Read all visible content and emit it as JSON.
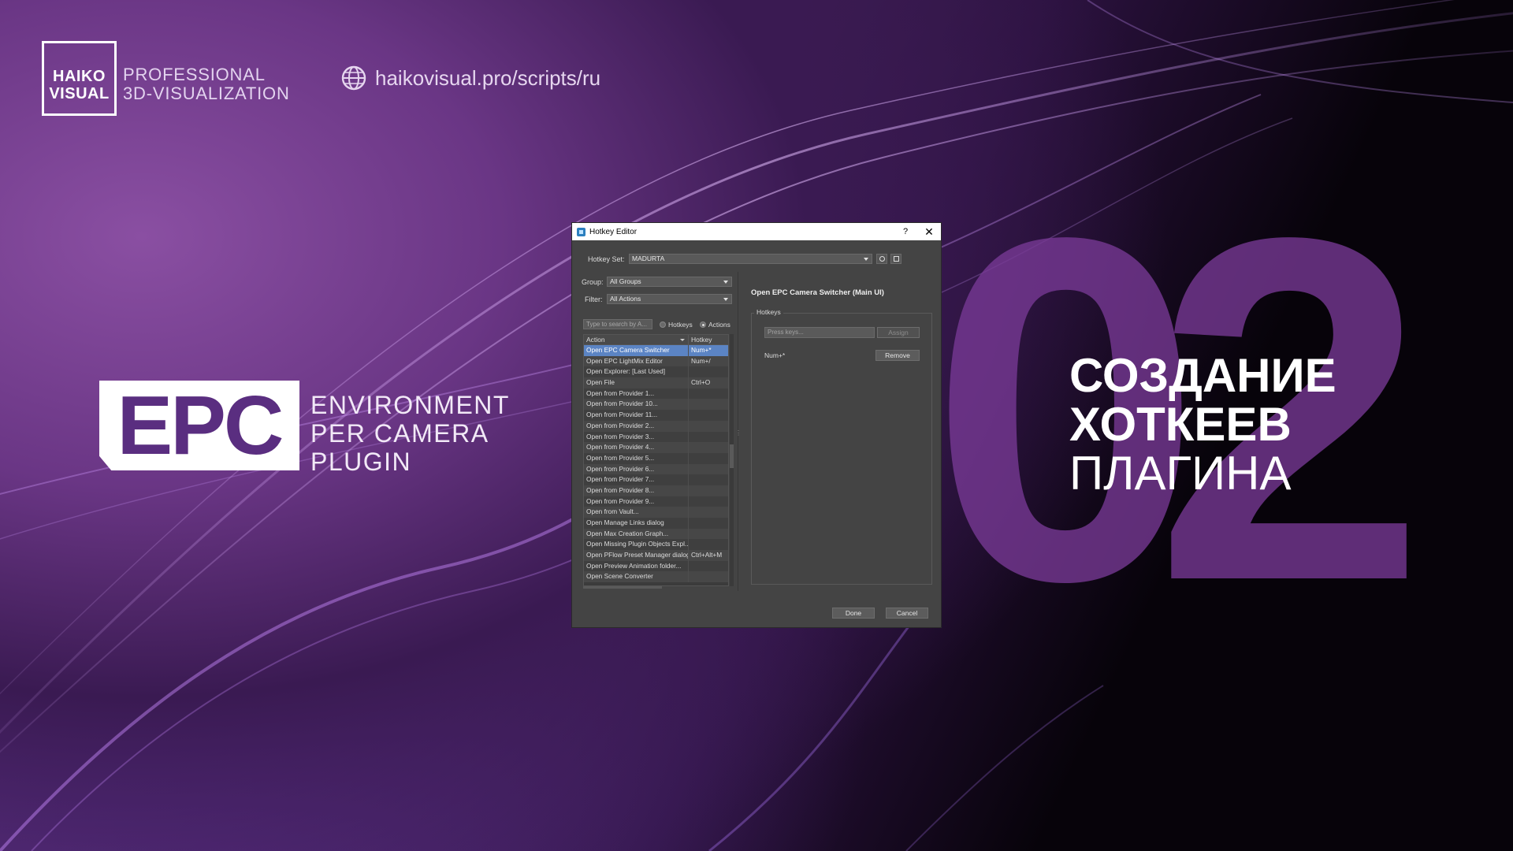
{
  "brand": {
    "box_line1": "HAIKO",
    "box_line2": "VISUAL",
    "tagline_line1": "PROFESSIONAL",
    "tagline_line2": "3D-VISUALIZATION",
    "url": "haikovisual.pro/scripts/ru"
  },
  "product": {
    "logo_text": "EPC",
    "name_line1": "ENVIRONMENT",
    "name_line2": "PER CAMERA",
    "name_line3": "PLUGIN"
  },
  "episode": {
    "number": "02",
    "heading_line1": "СОЗДАНИЕ",
    "heading_line2": "ХОТКЕЕВ",
    "heading_line3": "ПЛАГИНА"
  },
  "dialog": {
    "title": "Hotkey Editor",
    "help_glyph": "?",
    "close_glyph": "✕",
    "hotkey_set_label": "Hotkey Set:",
    "hotkey_set_value": "MADURTA",
    "group_label": "Group:",
    "group_value": "All Groups",
    "filter_label": "Filter:",
    "filter_value": "All Actions",
    "search_placeholder": "Type to search by A...",
    "radio_hotkeys": "Hotkeys",
    "radio_actions": "Actions",
    "col_action": "Action",
    "col_hotkey": "Hotkey",
    "rows": [
      {
        "action": "Open EPC Camera Switcher",
        "hotkey": "Num+*",
        "selected": true
      },
      {
        "action": "Open EPC LightMix Editor",
        "hotkey": "Num+/"
      },
      {
        "action": "Open Explorer: [Last Used]",
        "hotkey": ""
      },
      {
        "action": "Open File",
        "hotkey": "Ctrl+O"
      },
      {
        "action": "Open from Provider 1...",
        "hotkey": ""
      },
      {
        "action": "Open from Provider 10...",
        "hotkey": ""
      },
      {
        "action": "Open from Provider 11...",
        "hotkey": ""
      },
      {
        "action": "Open from Provider 2...",
        "hotkey": ""
      },
      {
        "action": "Open from Provider 3...",
        "hotkey": ""
      },
      {
        "action": "Open from Provider 4...",
        "hotkey": ""
      },
      {
        "action": "Open from Provider 5...",
        "hotkey": ""
      },
      {
        "action": "Open from Provider 6...",
        "hotkey": ""
      },
      {
        "action": "Open from Provider 7...",
        "hotkey": ""
      },
      {
        "action": "Open from Provider 8...",
        "hotkey": ""
      },
      {
        "action": "Open from Provider 9...",
        "hotkey": ""
      },
      {
        "action": "Open from Vault...",
        "hotkey": ""
      },
      {
        "action": "Open Manage Links dialog",
        "hotkey": ""
      },
      {
        "action": "Open Max Creation Graph...",
        "hotkey": ""
      },
      {
        "action": "Open Missing Plugin Objects Expl...",
        "hotkey": ""
      },
      {
        "action": "Open PFlow Preset Manager dialog",
        "hotkey": "Ctrl+Alt+M"
      },
      {
        "action": "Open Preview Animation folder...",
        "hotkey": ""
      },
      {
        "action": "Open Scene Converter",
        "hotkey": ""
      }
    ],
    "detail_title": "Open EPC Camera Switcher (Main UI)",
    "hotkeys_group_label": "Hotkeys",
    "press_keys_placeholder": "Press keys...",
    "assign_label": "Assign",
    "assigned_key": "Num+*",
    "remove_label": "Remove",
    "done_label": "Done",
    "cancel_label": "Cancel"
  }
}
